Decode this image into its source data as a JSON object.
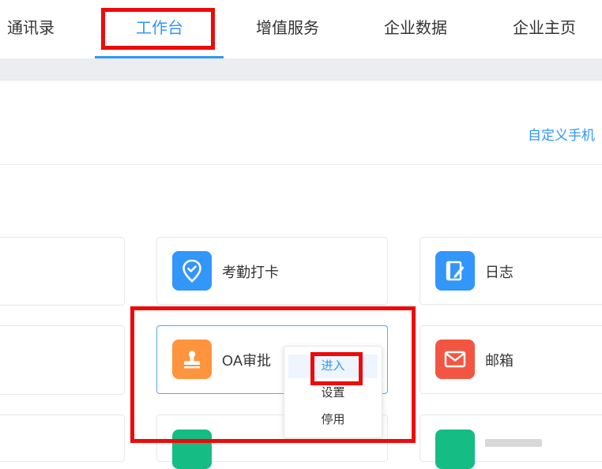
{
  "nav": {
    "items": [
      {
        "label": "通讯录",
        "active": false
      },
      {
        "label": "工作台",
        "active": true
      },
      {
        "label": "增值服务",
        "active": false
      },
      {
        "label": "企业数据",
        "active": false
      },
      {
        "label": "企业主页",
        "active": false
      }
    ],
    "accent_color": "#3296fa"
  },
  "header": {
    "customize_link": "自定义手机"
  },
  "apps": [
    {
      "label": "",
      "icon": "blank",
      "color": ""
    },
    {
      "label": "考勤打卡",
      "icon": "location-check-icon",
      "color": "#3296fa"
    },
    {
      "label": "日志",
      "icon": "journal-pen-icon",
      "color": "#3296fa"
    },
    {
      "label": "",
      "icon": "blank",
      "color": ""
    },
    {
      "label": "OA审批",
      "icon": "stamp-icon",
      "color": "#ff943e"
    },
    {
      "label": "邮箱",
      "icon": "mail-icon",
      "color": "#f25643"
    },
    {
      "label": "",
      "icon": "blank",
      "color": ""
    },
    {
      "label": "",
      "icon": "green-app-icon",
      "color": "#15bc83"
    },
    {
      "label": "",
      "icon": "green-app-icon",
      "color": "#15bc83"
    }
  ],
  "context_menu": {
    "items": [
      "进入",
      "设置",
      "停用"
    ]
  },
  "annotation_color": "#ee0a0a"
}
